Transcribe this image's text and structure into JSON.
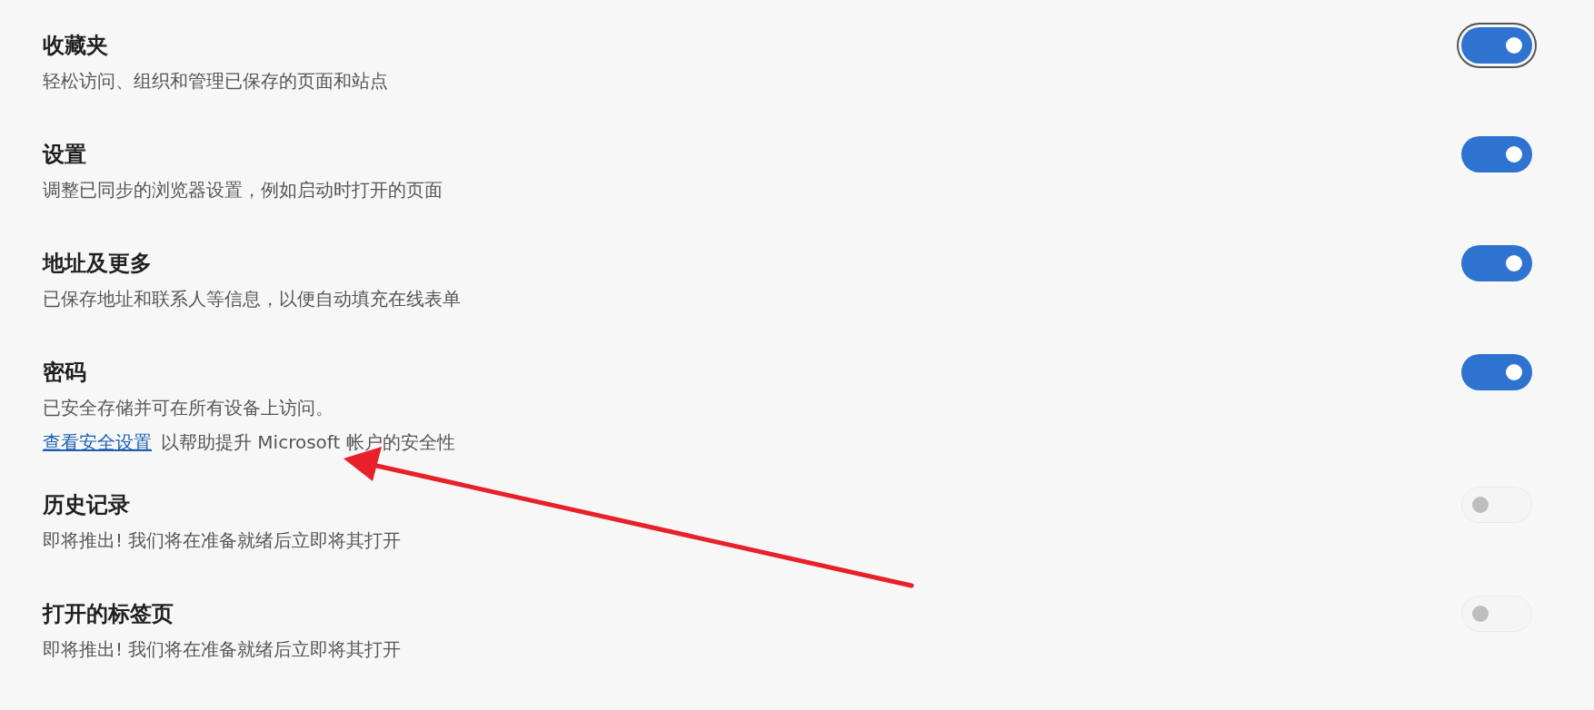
{
  "settings": [
    {
      "title": "收藏夹",
      "description": "轻松访问、组织和管理已保存的页面和站点",
      "on": true,
      "disabled": false,
      "focused": true
    },
    {
      "title": "设置",
      "description": "调整已同步的浏览器设置，例如启动时打开的页面",
      "on": true,
      "disabled": false,
      "focused": false
    },
    {
      "title": "地址及更多",
      "description": "已保存地址和联系人等信息，以便自动填充在线表单",
      "on": true,
      "disabled": false,
      "focused": false
    },
    {
      "title": "密码",
      "description": "已安全存储并可在所有设备上访问。",
      "note": {
        "link": "查看安全设置",
        "text": "以帮助提升 Microsoft 帐户的安全性"
      },
      "on": true,
      "disabled": false,
      "focused": false
    },
    {
      "title": "历史记录",
      "description": "即将推出! 我们将在准备就绪后立即将其打开",
      "on": false,
      "disabled": true,
      "focused": false
    },
    {
      "title": "打开的标签页",
      "description": "即将推出! 我们将在准备就绪后立即将其打开",
      "on": false,
      "disabled": true,
      "focused": false
    }
  ]
}
